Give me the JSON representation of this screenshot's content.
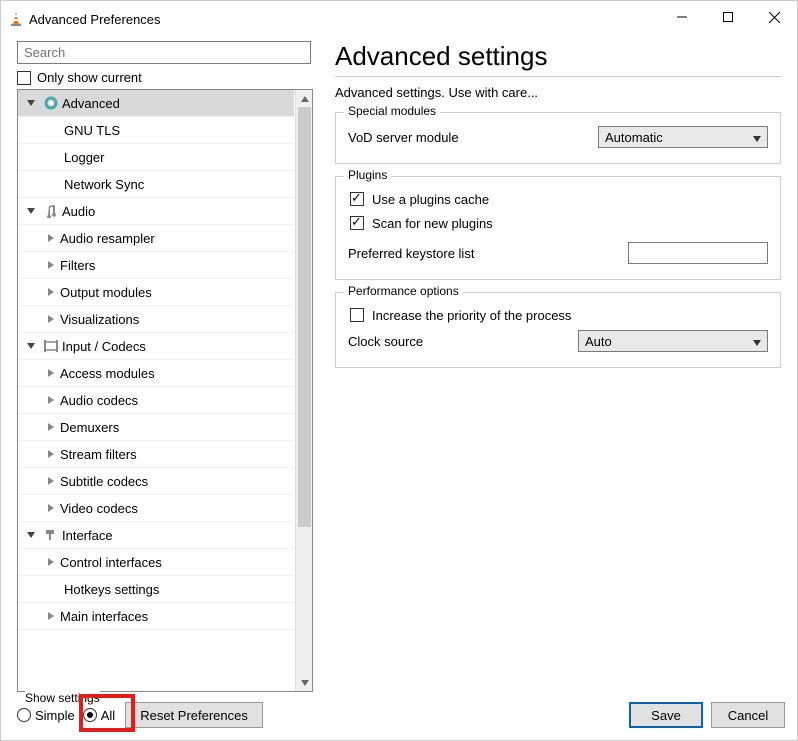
{
  "window": {
    "title": "Advanced Preferences"
  },
  "search": {
    "placeholder": "Search"
  },
  "only_show_current": "Only show current",
  "tree": {
    "advanced": "Advanced",
    "gnu_tls": "GNU TLS",
    "logger": "Logger",
    "network_sync": "Network Sync",
    "audio": "Audio",
    "audio_resampler": "Audio resampler",
    "filters": "Filters",
    "output_modules": "Output modules",
    "visualizations": "Visualizations",
    "input_codecs": "Input / Codecs",
    "access_modules": "Access modules",
    "audio_codecs": "Audio codecs",
    "demuxers": "Demuxers",
    "stream_filters": "Stream filters",
    "subtitle_codecs": "Subtitle codecs",
    "video_codecs": "Video codecs",
    "interface": "Interface",
    "control_interfaces": "Control interfaces",
    "hotkeys_settings": "Hotkeys settings",
    "main_interfaces": "Main interfaces"
  },
  "panel": {
    "heading": "Advanced settings",
    "desc": "Advanced settings. Use with care...",
    "special_modules": {
      "title": "Special modules",
      "vod_label": "VoD server module",
      "vod_value": "Automatic"
    },
    "plugins": {
      "title": "Plugins",
      "use_cache": "Use a plugins cache",
      "scan_new": "Scan for new plugins",
      "keystore_label": "Preferred keystore list"
    },
    "performance": {
      "title": "Performance options",
      "increase_priority": "Increase the priority of the process",
      "clock_label": "Clock source",
      "clock_value": "Auto"
    }
  },
  "bottom": {
    "show_settings": "Show settings",
    "simple": "Simple",
    "all": "All",
    "reset": "Reset Preferences",
    "save": "Save",
    "cancel": "Cancel"
  }
}
